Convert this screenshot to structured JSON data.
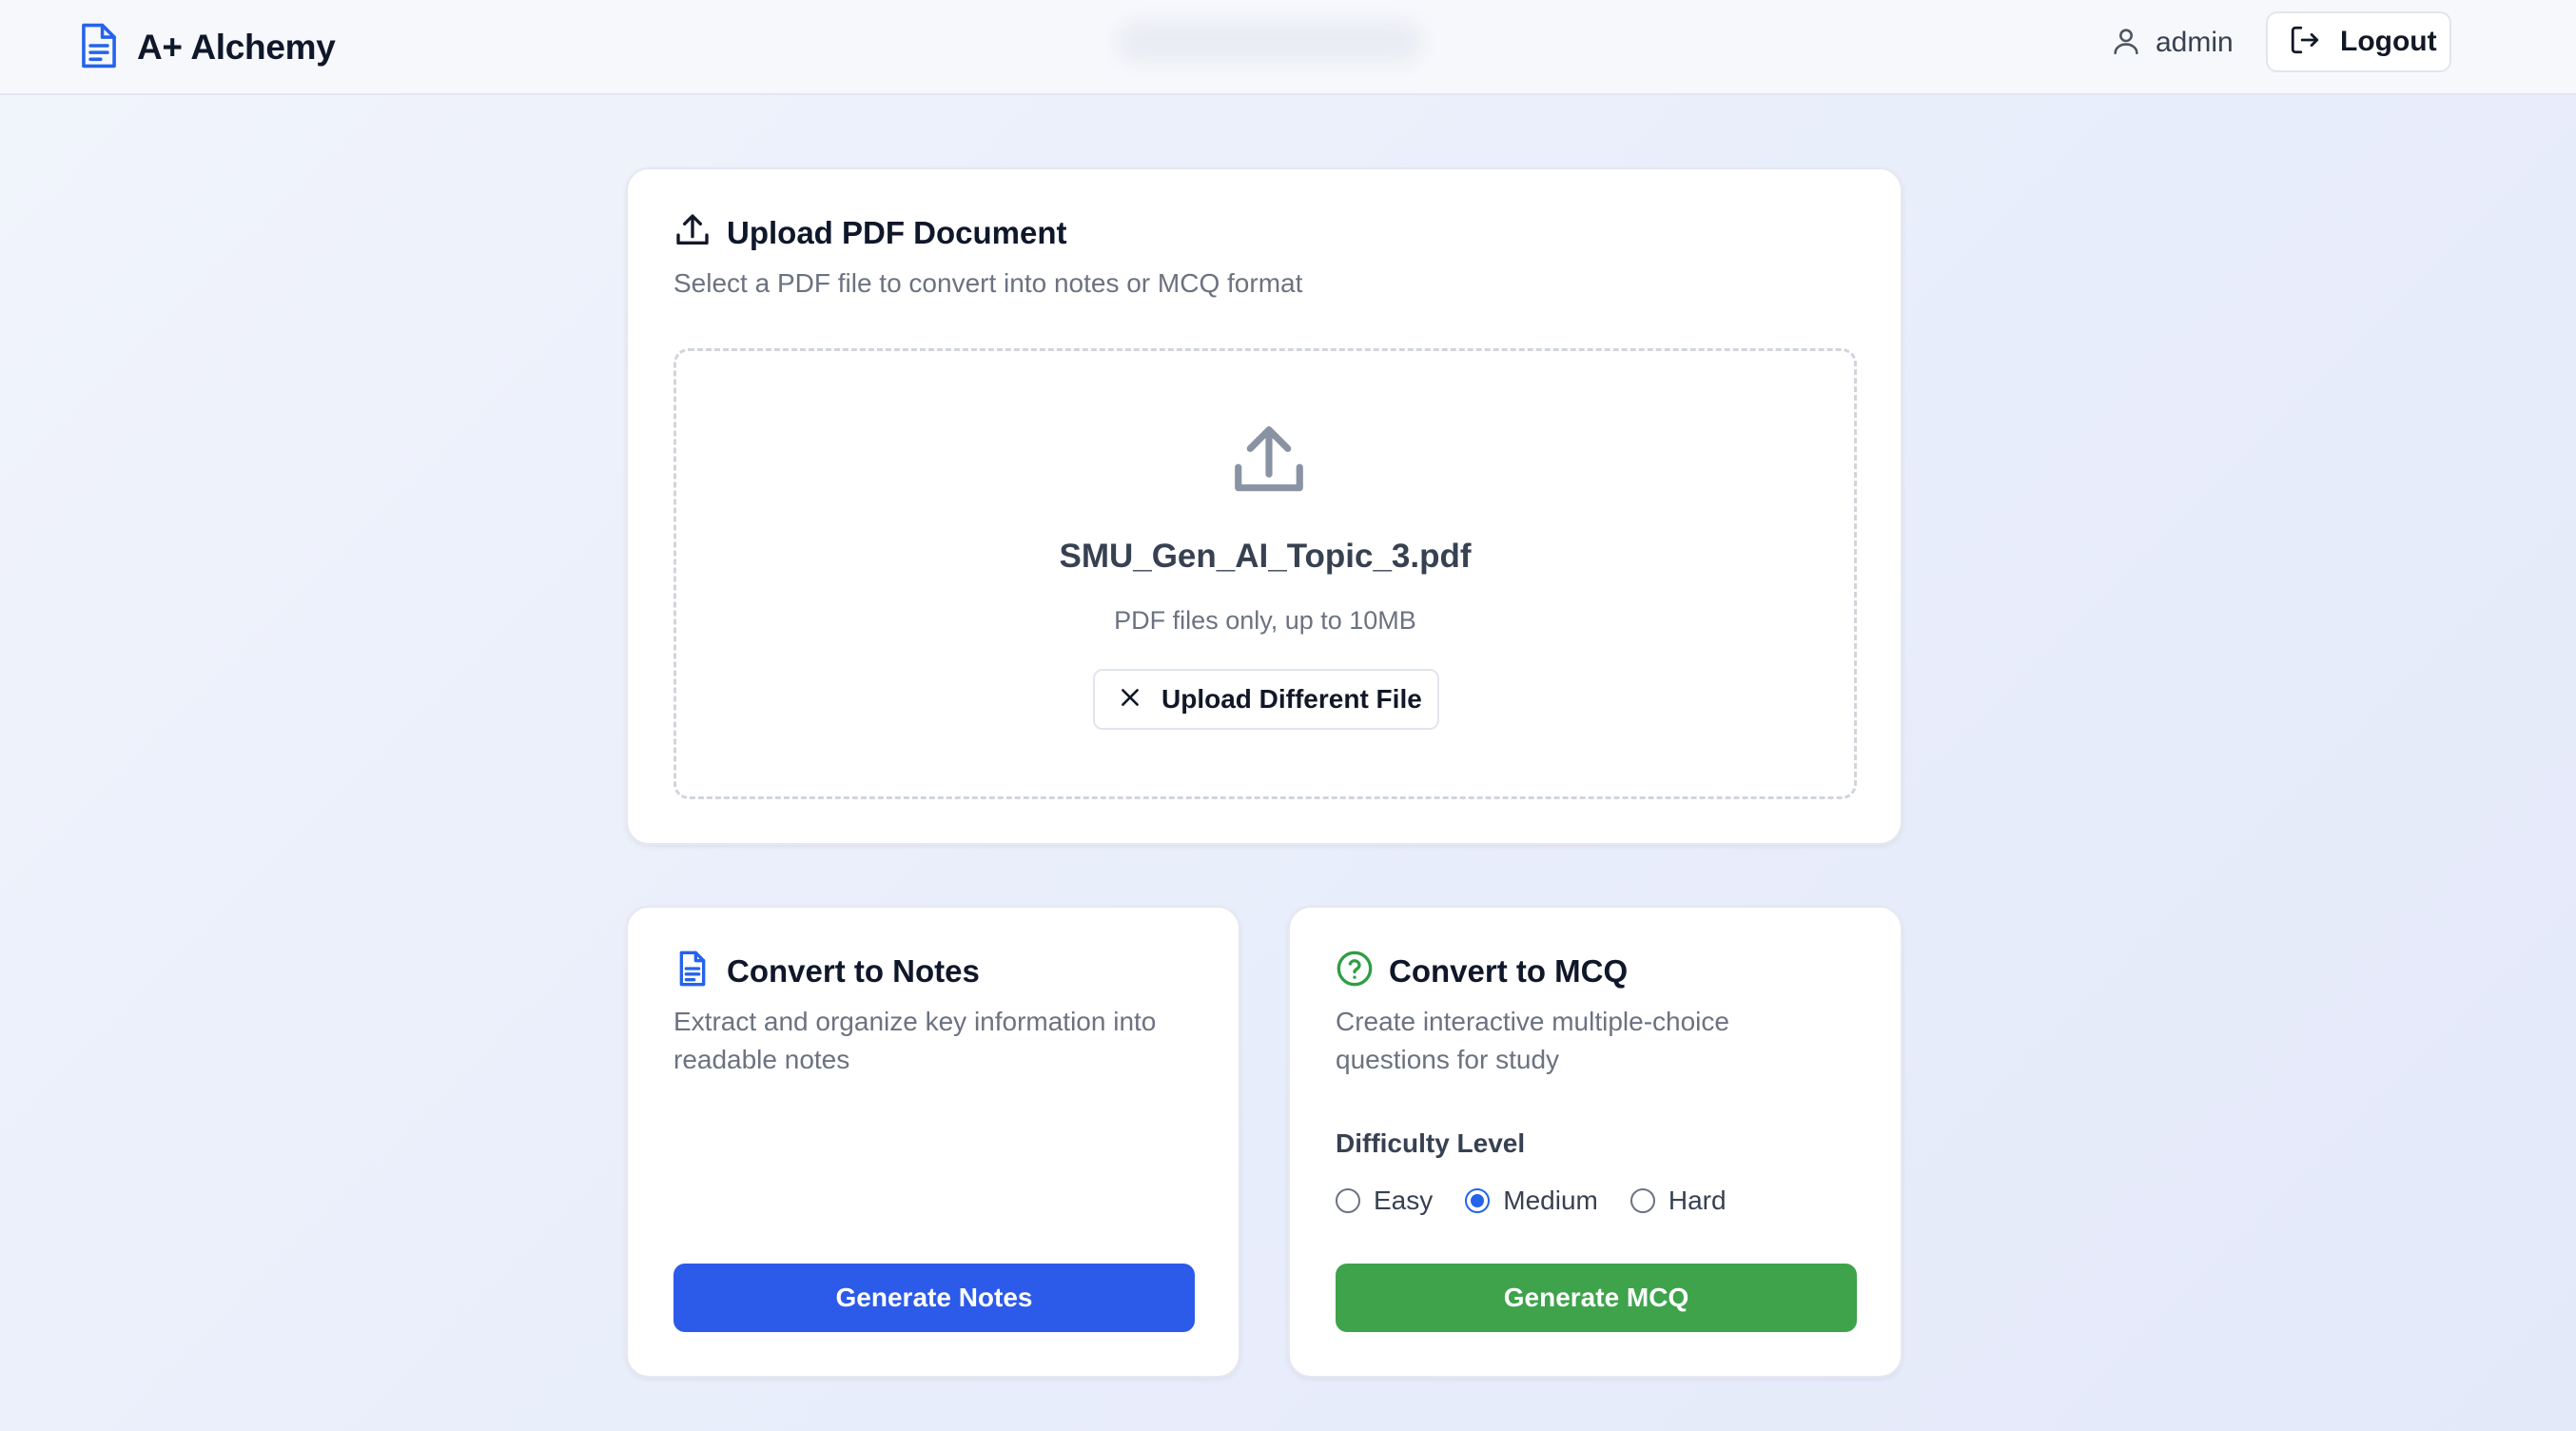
{
  "header": {
    "app_name": "A+ Alchemy",
    "brand_icon": "document-icon",
    "user_name": "admin",
    "logout_label": "Logout"
  },
  "upload": {
    "title": "Upload PDF Document",
    "description": "Select a PDF file to convert into notes or MCQ format",
    "file_name": "SMU_Gen_AI_Topic_3.pdf",
    "hint": "PDF files only, up to 10MB",
    "change_button": "Upload Different File"
  },
  "notes": {
    "title": "Convert to Notes",
    "description_line1": "Extract and organize key information into",
    "description_line2": "readable notes",
    "button": "Generate Notes"
  },
  "mcq": {
    "title": "Convert to MCQ",
    "description_line1": "Create interactive multiple-choice",
    "description_line2": "questions for study",
    "difficulty_label": "Difficulty Level",
    "options": [
      "Easy",
      "Medium",
      "Hard"
    ],
    "selected": "Medium",
    "button": "Generate MCQ"
  },
  "colors": {
    "brand_blue": "#2c5ae9",
    "mcq_green": "#3ea34b",
    "radio_selected": "#2563eb"
  }
}
